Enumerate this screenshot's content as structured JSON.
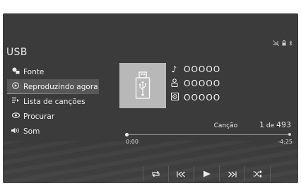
{
  "source_title": "USB",
  "menu": {
    "items": [
      {
        "label": "Fonte",
        "icon": "source-icon"
      },
      {
        "label": "Reproduzindo agora",
        "icon": "now-playing-icon",
        "active": true
      },
      {
        "label": "Lista de canções",
        "icon": "song-list-icon"
      },
      {
        "label": "Procurar",
        "icon": "browse-icon"
      },
      {
        "label": "Som",
        "icon": "sound-icon"
      }
    ]
  },
  "track": {
    "song": "OOOOO",
    "artist": "OOOOO",
    "album": "OOOOO"
  },
  "counter": {
    "label": "Canção",
    "current": "1",
    "of": "de",
    "total": "493"
  },
  "progress": {
    "elapsed": "0:00",
    "remaining": "-4:25",
    "fraction": 0
  },
  "controls": [
    "repeat",
    "previous",
    "play",
    "next",
    "shuffle"
  ],
  "colors": {
    "background": "#3b3b3b",
    "active_item": "#575757",
    "album_art": "#b8b8b8"
  }
}
